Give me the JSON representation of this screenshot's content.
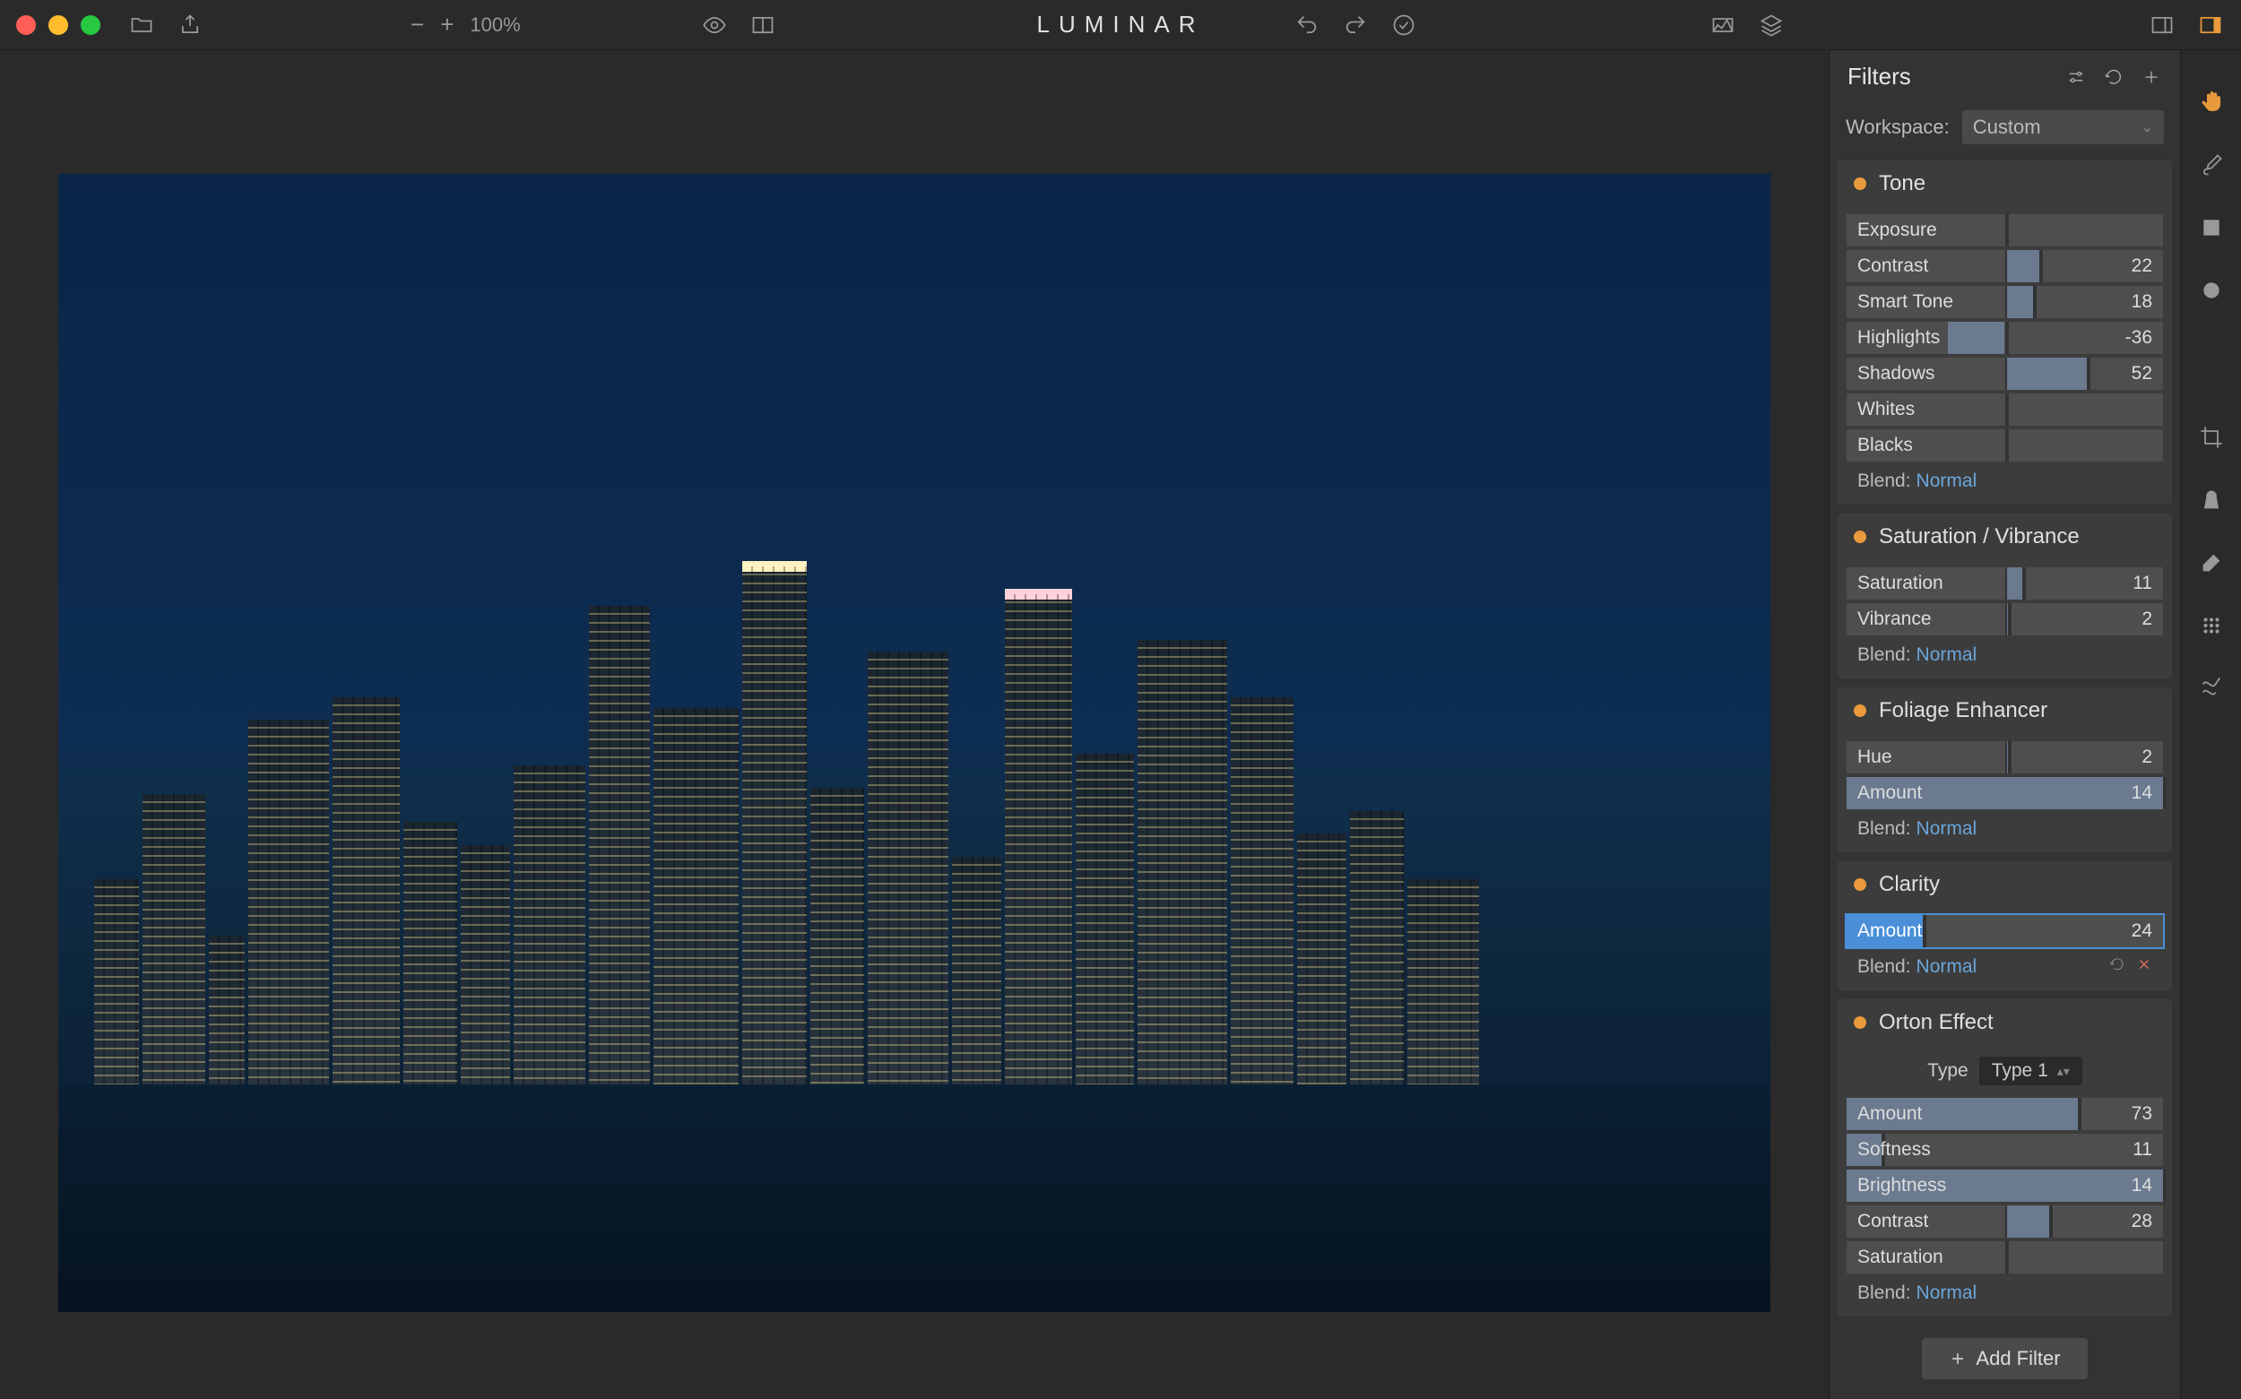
{
  "app_title": "LUMINAR",
  "zoom": "100%",
  "panel_title": "Filters",
  "workspace_label": "Workspace:",
  "workspace_value": "Custom",
  "add_filter_label": "Add Filter",
  "blend_label": "Blend:",
  "type_label": "Type",
  "type_value": "Type 1",
  "filters": [
    {
      "name": "Tone",
      "bipolar": true,
      "sliders": [
        {
          "label": "Exposure",
          "value": "",
          "fill_from": 50,
          "fill_to": 50
        },
        {
          "label": "Contrast",
          "value": "22",
          "fill_from": 50,
          "fill_to": 61
        },
        {
          "label": "Smart Tone",
          "value": "18",
          "fill_from": 50,
          "fill_to": 59
        },
        {
          "label": "Highlights",
          "value": "-36",
          "fill_from": 32,
          "fill_to": 50
        },
        {
          "label": "Shadows",
          "value": "52",
          "fill_from": 50,
          "fill_to": 76
        },
        {
          "label": "Whites",
          "value": "",
          "fill_from": 50,
          "fill_to": 50
        },
        {
          "label": "Blacks",
          "value": "",
          "fill_from": 50,
          "fill_to": 50
        }
      ],
      "blend": "Normal"
    },
    {
      "name": "Saturation / Vibrance",
      "bipolar": true,
      "sliders": [
        {
          "label": "Saturation",
          "value": "11",
          "fill_from": 50,
          "fill_to": 55.5
        },
        {
          "label": "Vibrance",
          "value": "2",
          "fill_from": 50,
          "fill_to": 51
        }
      ],
      "blend": "Normal"
    },
    {
      "name": "Foliage Enhancer",
      "bipolar": true,
      "sliders": [
        {
          "label": "Hue",
          "value": "2",
          "fill_from": 50,
          "fill_to": 51
        },
        {
          "label": "Amount",
          "value": "14",
          "fill_from": 0,
          "fill_to": 100,
          "uniform": true
        }
      ],
      "blend": "Normal"
    },
    {
      "name": "Clarity",
      "bipolar": false,
      "sliders": [
        {
          "label": "Amount",
          "value": "24",
          "fill_from": 0,
          "fill_to": 24,
          "uniform": true,
          "highlighted": true
        }
      ],
      "blend": "Normal",
      "show_extra_icons": true
    },
    {
      "name": "Orton Effect",
      "bipolar": false,
      "has_type": true,
      "sliders": [
        {
          "label": "Amount",
          "value": "73",
          "fill_from": 0,
          "fill_to": 73,
          "uniform": true
        },
        {
          "label": "Softness",
          "value": "11",
          "fill_from": 0,
          "fill_to": 11,
          "uniform": true
        },
        {
          "label": "Brightness",
          "value": "14",
          "fill_from": 0,
          "fill_to": 100,
          "uniform": true
        },
        {
          "label": "Contrast",
          "value": "28",
          "fill_from": 50,
          "fill_to": 64
        },
        {
          "label": "Saturation",
          "value": "",
          "fill_from": 50,
          "fill_to": 50
        }
      ],
      "blend": "Normal"
    }
  ]
}
